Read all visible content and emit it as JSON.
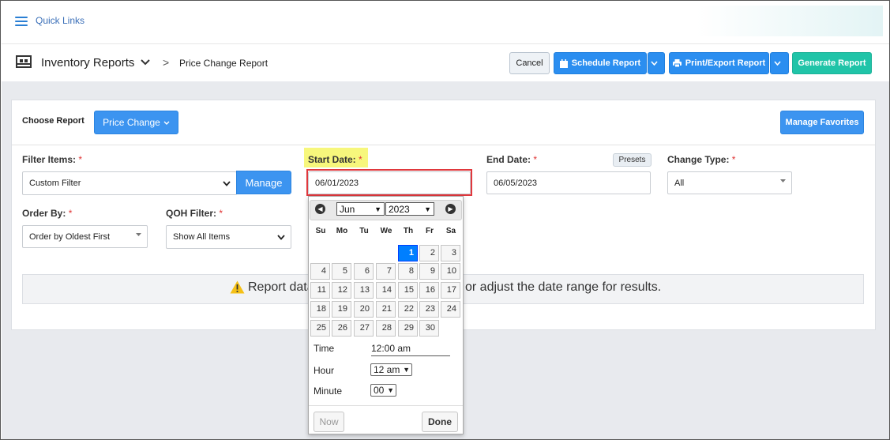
{
  "topbar": {
    "quick_links": "Quick Links"
  },
  "titlebar": {
    "module": "Inventory Reports",
    "breadcrumb_sep": ">",
    "current_page": "Price Change Report",
    "buttons": {
      "cancel": "Cancel",
      "schedule": "Schedule Report",
      "print_export": "Print/Export Report",
      "generate": "Generate Report"
    }
  },
  "report": {
    "choose_label": "Choose Report",
    "selected_report": "Price Change",
    "manage_favorites": "Manage Favorites"
  },
  "filters": {
    "filter_items": {
      "label": "Filter Items:",
      "required": "*",
      "value": "Custom Filter",
      "manage": "Manage"
    },
    "start_date": {
      "label": "Start Date:",
      "required": "*",
      "value": "06/01/2023"
    },
    "end_date": {
      "label": "End Date:",
      "required": "*",
      "value": "06/05/2023",
      "presets": "Presets"
    },
    "change_type": {
      "label": "Change Type:",
      "required": "*",
      "value": "All"
    },
    "order_by": {
      "label": "Order By:",
      "required": "*",
      "value": "Order by Oldest First"
    },
    "qoh_filter": {
      "label": "QOH Filter:",
      "required": "*",
      "value": "Show All Items"
    }
  },
  "warning": {
    "text_left": "Report data",
    "text_right": "or adjust the date range for results."
  },
  "calendar": {
    "month": "Jun",
    "year": "2023",
    "weekdays": [
      "Su",
      "Mo",
      "Tu",
      "We",
      "Th",
      "Fr",
      "Sa"
    ],
    "selected_day": "1",
    "time_label": "Time",
    "time_value": "12:00 am",
    "hour_label": "Hour",
    "hour_value": "12 am",
    "minute_label": "Minute",
    "minute_value": "00",
    "now": "Now",
    "done": "Done"
  },
  "colors": {
    "primary": "#3c94f0",
    "generate": "#20c4a8",
    "highlight": "#f7f77c",
    "focus_box": "#e0383d",
    "selected_day": "#007fff"
  }
}
